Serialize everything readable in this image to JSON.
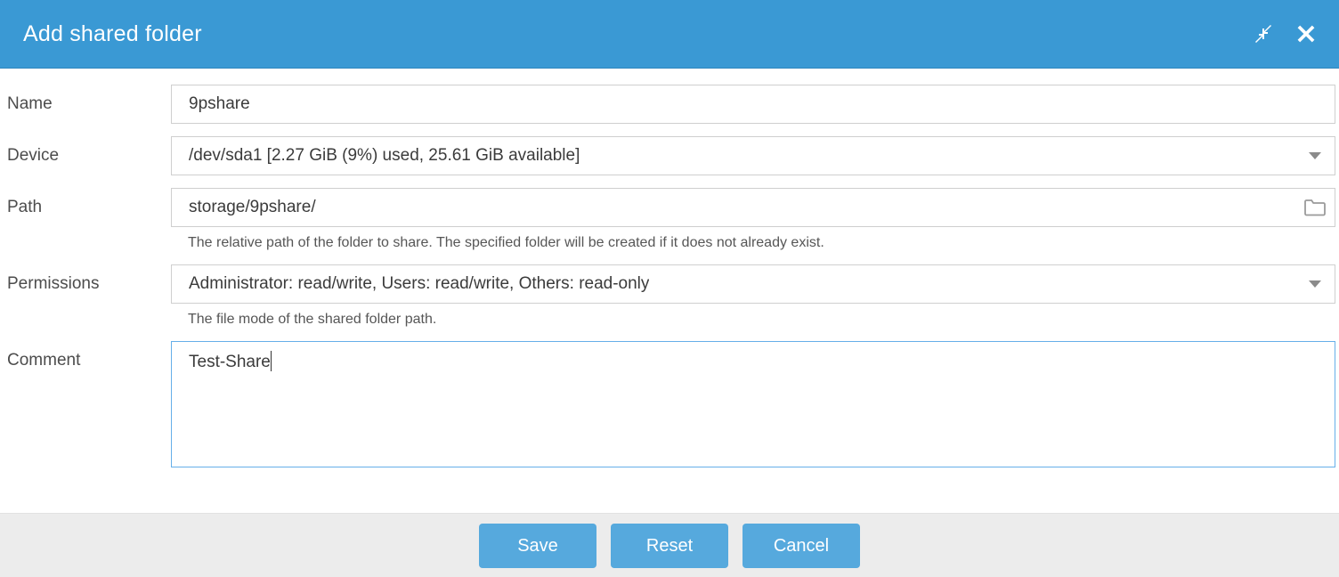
{
  "header": {
    "title": "Add shared folder",
    "icons": [
      {
        "name": "collapse-icon",
        "label": "Collapse"
      },
      {
        "name": "close-icon",
        "label": "Close"
      }
    ]
  },
  "form": {
    "name": {
      "label": "Name",
      "value": "9pshare",
      "placeholder": ""
    },
    "device": {
      "label": "Device",
      "value": "/dev/sda1 [2.27 GiB (9%) used, 25.61 GiB available]",
      "options": [
        "/dev/sda1 [2.27 GiB (9%) used, 25.61 GiB available]"
      ]
    },
    "path": {
      "label": "Path",
      "value": "storage/9pshare/",
      "hint": "The relative path of the folder to share. The specified folder will be created if it does not already exist."
    },
    "permissions": {
      "label": "Permissions",
      "value": "Administrator: read/write, Users: read/write, Others: read-only",
      "hint": "The file mode of the shared folder path.",
      "options": [
        "Administrator: read/write, Users: read/write, Others: read-only"
      ]
    },
    "comment": {
      "label": "Comment",
      "value": "Test-Share",
      "placeholder": ""
    }
  },
  "footer": {
    "save_label": "Save",
    "reset_label": "Reset",
    "cancel_label": "Cancel"
  },
  "colors": {
    "header_blue": "#3a99d4",
    "button_blue": "#56a9dd",
    "footer_gray": "#ececec",
    "focus_border": "#66afe9",
    "field_border": "#cfcfcf"
  }
}
